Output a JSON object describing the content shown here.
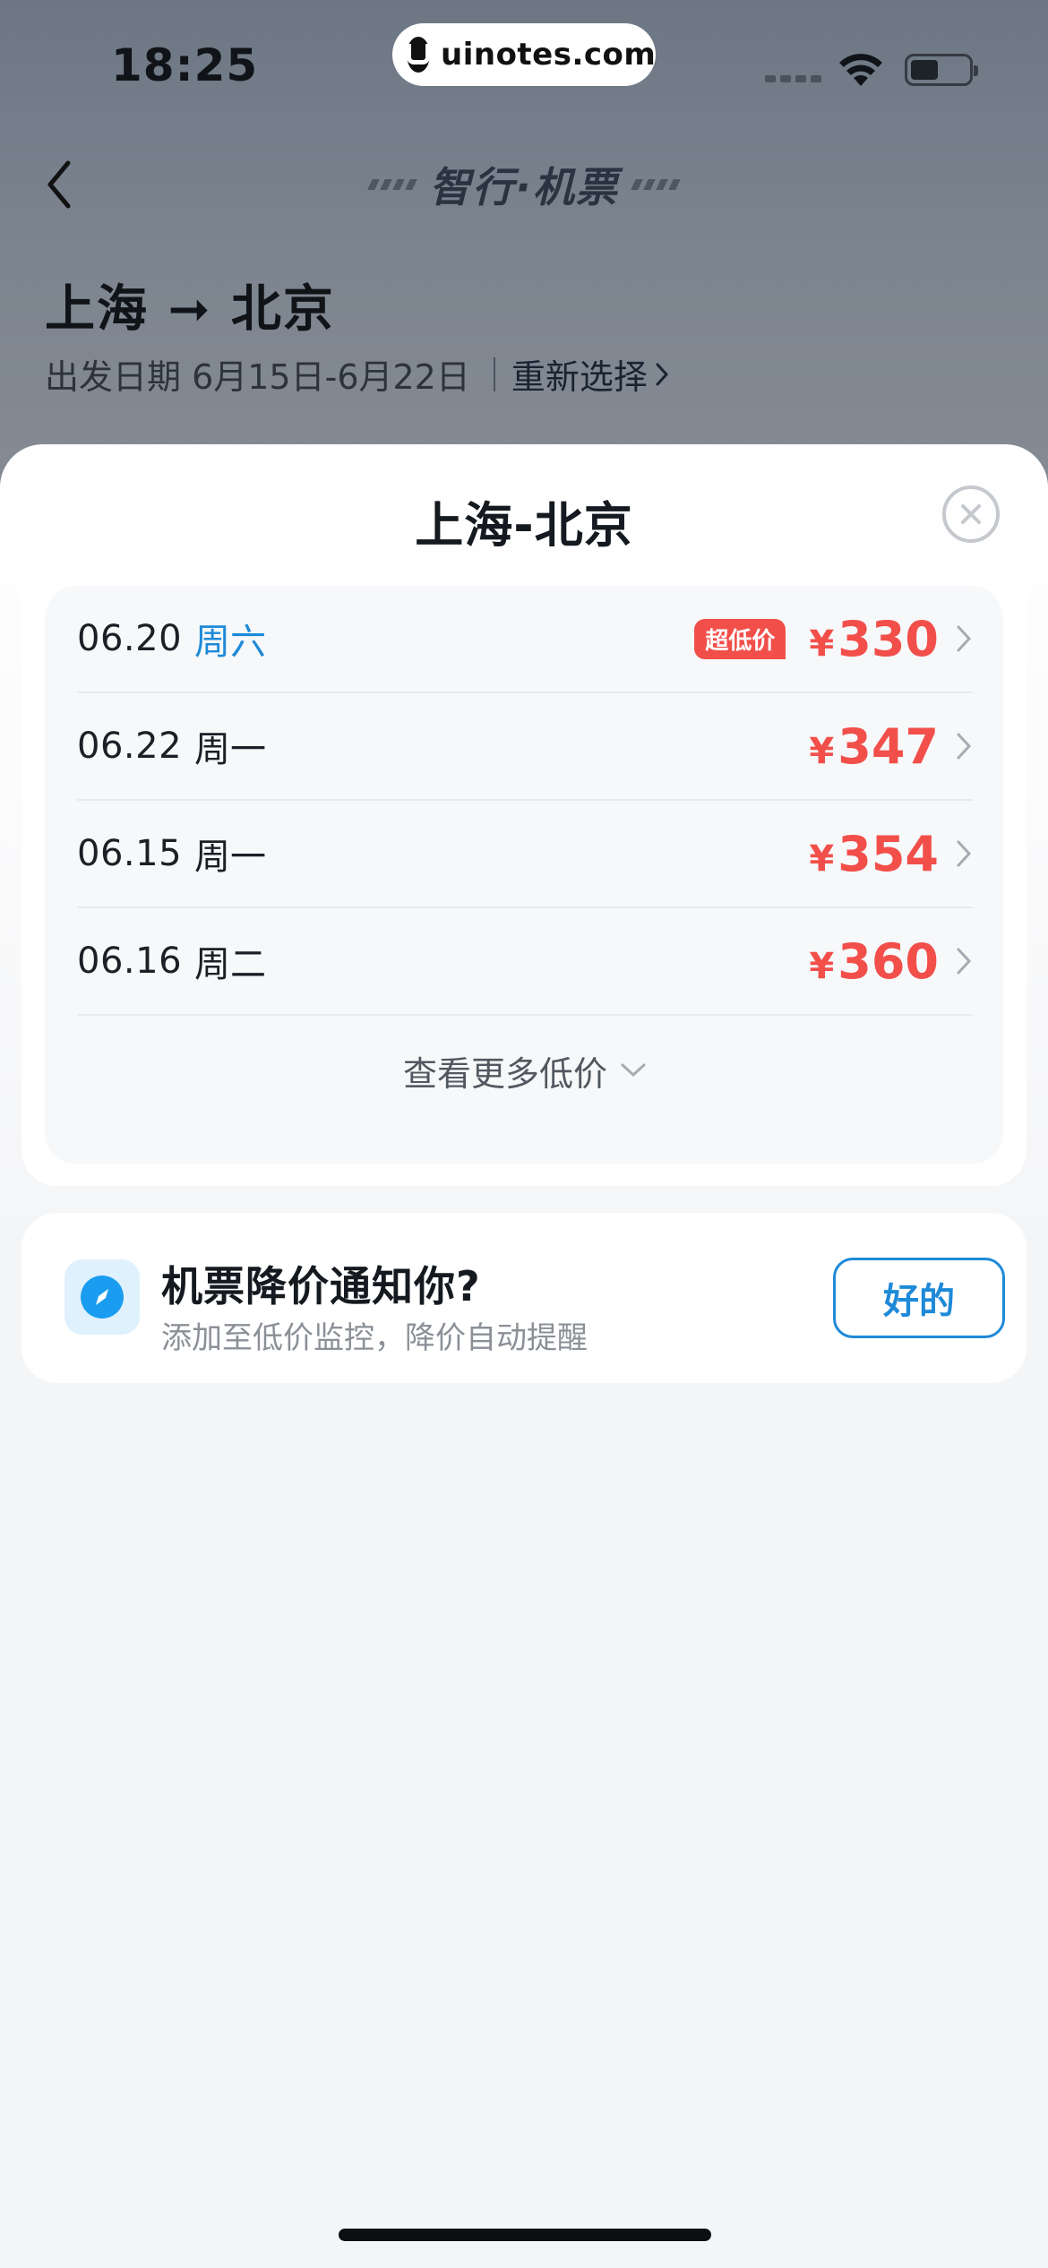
{
  "status_bar": {
    "time": "18:25",
    "url": "uinotes.com",
    "icons": [
      "uinotes-logo-icon",
      "wifi-icon",
      "battery-icon"
    ]
  },
  "background_page": {
    "nav_title": "智行·机票",
    "route": "上海 ➞ 北京",
    "date_label": "出发日期 6月15日-6月22日",
    "reselect_label": "重新选择"
  },
  "sheet": {
    "title": "上海-北京",
    "prices": [
      {
        "date": "06.20",
        "weekday": "周六",
        "badge": "超低价",
        "currency": "¥",
        "price": "330",
        "weekday_highlight": true
      },
      {
        "date": "06.22",
        "weekday": "周一",
        "badge": "",
        "currency": "¥",
        "price": "347",
        "weekday_highlight": false
      },
      {
        "date": "06.15",
        "weekday": "周一",
        "badge": "",
        "currency": "¥",
        "price": "354",
        "weekday_highlight": false
      },
      {
        "date": "06.16",
        "weekday": "周二",
        "badge": "",
        "currency": "¥",
        "price": "360",
        "weekday_highlight": false
      }
    ],
    "more_label": "查看更多低价"
  },
  "notify": {
    "title": "机票降价通知你?",
    "subtitle": "添加至低价监控，降价自动提醒",
    "button": "好的"
  },
  "colors": {
    "accent_blue": "#1e8ad8",
    "price_red": "#f24f4a"
  }
}
